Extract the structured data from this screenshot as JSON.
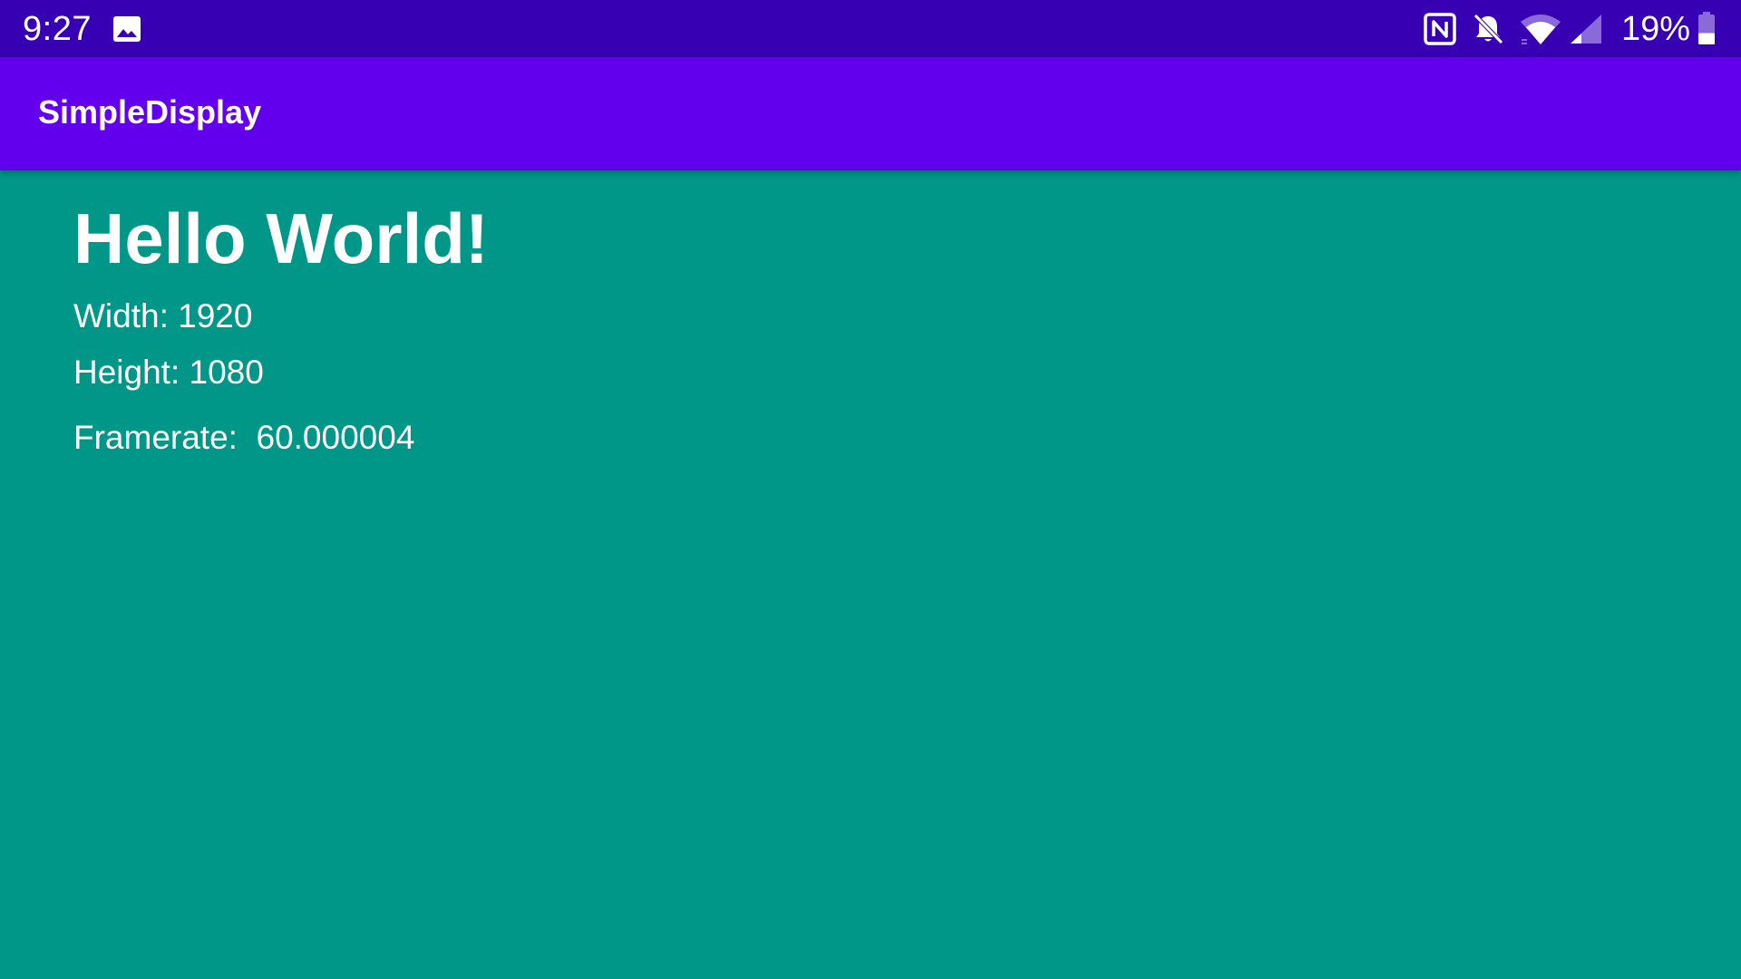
{
  "status_bar": {
    "time": "9:27",
    "battery_percent": "19%",
    "battery_level": 0.19,
    "icons": [
      "gallery-icon",
      "nfc-icon",
      "bell-off-icon",
      "wifi-icon",
      "signal-icon",
      "battery-icon"
    ]
  },
  "app_bar": {
    "title": "SimpleDisplay"
  },
  "main": {
    "heading": "Hello World!",
    "width_label": "Width: 1920",
    "height_label": "Height: 1080",
    "framerate_label": "Framerate:  60.000004"
  },
  "colors": {
    "status_bar": "#3700B3",
    "app_bar": "#6200EE",
    "background": "#009688",
    "text": "#FFFFFF"
  }
}
